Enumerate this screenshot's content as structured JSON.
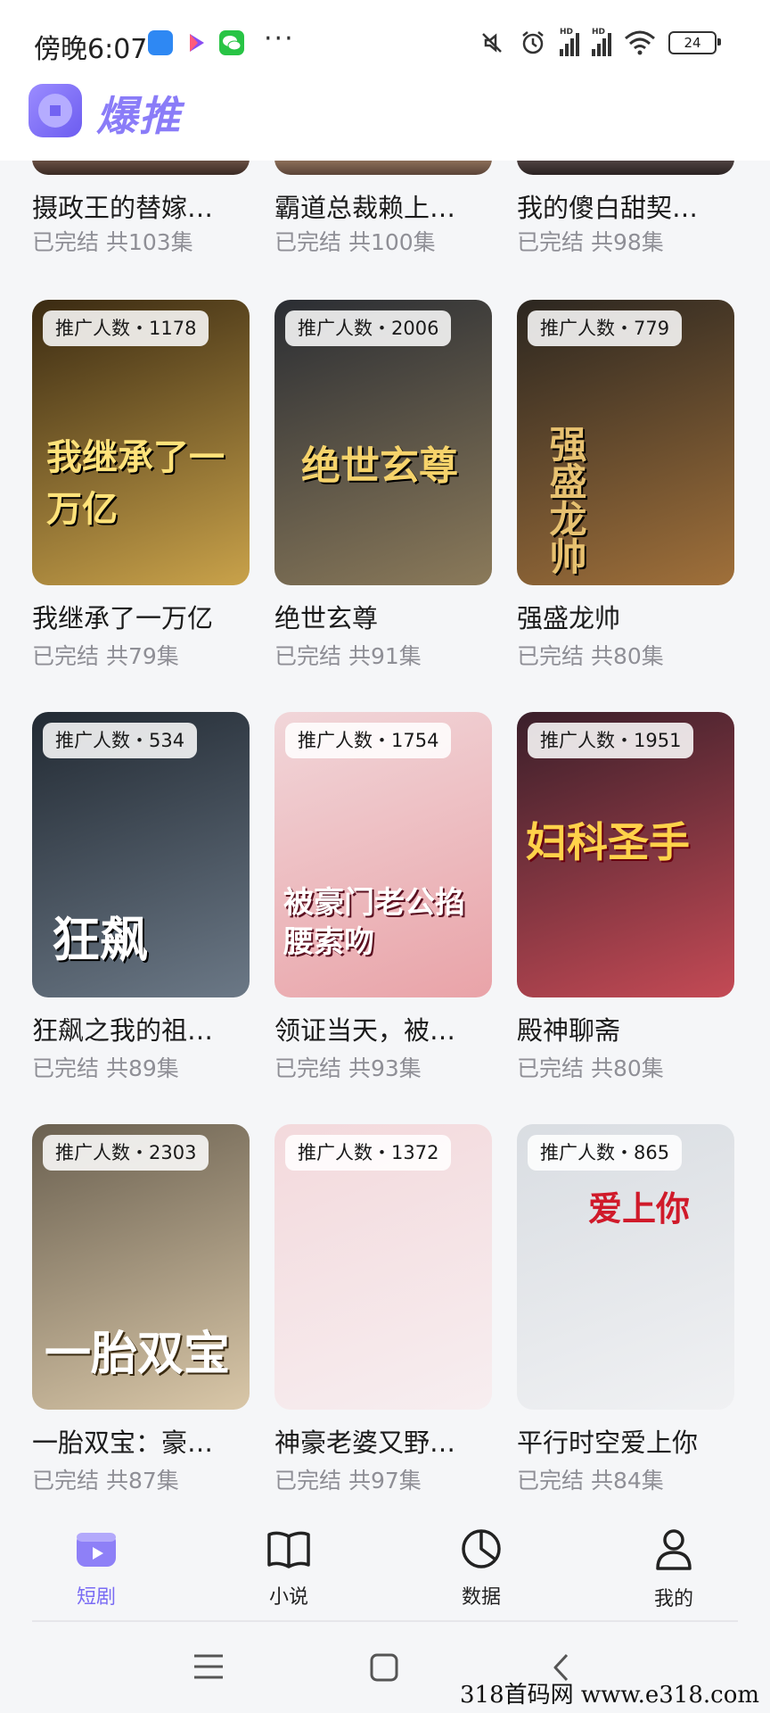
{
  "status_bar": {
    "time": "傍晚6:07",
    "more": "···",
    "battery": "24",
    "signal_label": "HD"
  },
  "app": {
    "name": "爆推"
  },
  "partial_row": [
    {
      "title": "摄政王的替嫁…",
      "status": "已完结 共103集"
    },
    {
      "title": "霸道总裁赖上…",
      "status": "已完结 共100集"
    },
    {
      "title": "我的傻白甜契…",
      "status": "已完结 共98集"
    }
  ],
  "dramas": [
    {
      "badge": "推广人数・1178",
      "title": "我继承了一万亿",
      "status": "已完结 共79集",
      "poster_text": "我继承了一万亿",
      "colors": [
        "#3a2a12",
        "#c9a24a"
      ]
    },
    {
      "badge": "推广人数・2006",
      "title": "绝世玄尊",
      "status": "已完结 共91集",
      "poster_text": "绝世玄尊",
      "colors": [
        "#2a2d33",
        "#8b7a5a"
      ]
    },
    {
      "badge": "推广人数・779",
      "title": "强盛龙帅",
      "status": "已完结 共80集",
      "poster_text": "强盛龙帅",
      "colors": [
        "#2b2620",
        "#a0703a"
      ]
    },
    {
      "badge": "推广人数・534",
      "title": "狂飙之我的祖…",
      "status": "已完结 共89集",
      "poster_text": "狂飙",
      "colors": [
        "#222a33",
        "#6b7886"
      ]
    },
    {
      "badge": "推广人数・1754",
      "title": "领证当天，被…",
      "status": "已完结 共93集",
      "poster_text": "被豪门老公掐腰索吻",
      "colors": [
        "#f1d6d9",
        "#e9a3a8"
      ]
    },
    {
      "badge": "推广人数・1951",
      "title": "殿神聊斋",
      "status": "已完结 共80集",
      "poster_text": "妇科圣手",
      "colors": [
        "#3a1f2a",
        "#c44a55"
      ]
    },
    {
      "badge": "推广人数・2303",
      "title": "一胎双宝：豪…",
      "status": "已完结 共87集",
      "poster_text": "一胎双宝",
      "colors": [
        "#6a6050",
        "#d9c7a8"
      ]
    },
    {
      "badge": "推广人数・1372",
      "title": "神豪老婆又野…",
      "status": "已完结 共97集",
      "poster_text": "",
      "colors": [
        "#f3d9dc",
        "#f7eef0"
      ]
    },
    {
      "badge": "推广人数・865",
      "title": "平行时空爱上你",
      "status": "已完结 共84集",
      "poster_text": "爱上你",
      "colors": [
        "#d9dde2",
        "#f0f1f3"
      ]
    }
  ],
  "tabs": [
    {
      "label": "短剧",
      "icon": "video-icon",
      "active": true
    },
    {
      "label": "小说",
      "icon": "book-icon",
      "active": false
    },
    {
      "label": "数据",
      "icon": "pie-chart-icon",
      "active": false
    },
    {
      "label": "我的",
      "icon": "user-icon",
      "active": false
    }
  ],
  "accent_color": "#7a6cf4",
  "watermark": "318首码网 www.e318.com"
}
